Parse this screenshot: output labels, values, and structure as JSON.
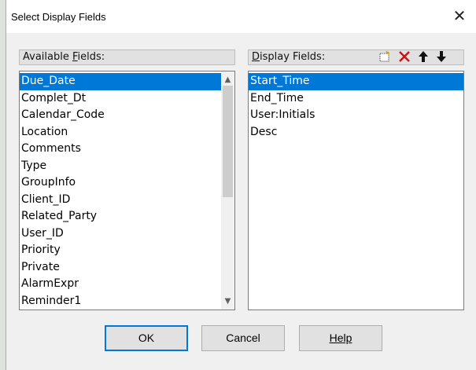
{
  "dialog": {
    "title": "Select Display Fields",
    "close_glyph": "✕"
  },
  "available": {
    "header": "Available Fields:",
    "items": [
      "Due_Date",
      "Complet_Dt",
      "Calendar_Code",
      "Location",
      "Comments",
      "Type",
      "GroupInfo",
      "Client_ID",
      "Related_Party",
      "User_ID",
      "Priority",
      "Private",
      "AlarmExpr",
      "Reminder1"
    ],
    "selected_index": 0
  },
  "display": {
    "header": "Display Fields:",
    "items": [
      "Start_Time",
      "End_Time",
      "User:Initials",
      "Desc"
    ],
    "selected_index": 0,
    "tools": {
      "new_icon": "new-field-icon",
      "delete_icon": "delete-icon",
      "up_icon": "move-up-icon",
      "down_icon": "move-down-icon"
    }
  },
  "buttons": {
    "ok": "OK",
    "cancel": "Cancel",
    "help": "Help"
  },
  "colors": {
    "selection": "#0078d7",
    "delete": "#cc1111"
  }
}
